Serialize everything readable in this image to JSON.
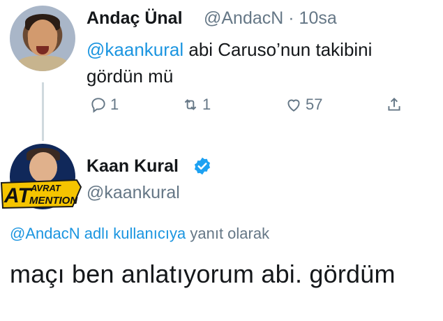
{
  "tweet1": {
    "display_name": "Andaç Ünal",
    "handle_time": "@AndacN · 10sa",
    "mention": "@kaankural",
    "text_after_mention": " abi Caruso’nun takibini",
    "text_line2": "gördün mü",
    "actions": {
      "reply_count": "1",
      "retweet_count": "1",
      "like_count": "57"
    }
  },
  "tweet2": {
    "display_name": "Kaan Kural",
    "handle": "@kaankural",
    "reply_mention": "@AndacN adlı kullanıcıya",
    "reply_suffix": " yanıt olarak",
    "text": "maçı ben anlatıyorum abi. gördüm"
  },
  "logo": {
    "line1": "AVRAT",
    "line2": "MENTION",
    "prefix": "AT"
  },
  "colors": {
    "link": "#1b95e0",
    "muted": "#657786",
    "text": "#14171a",
    "verified": "#1da1f2"
  },
  "icons": [
    "reply-icon",
    "retweet-icon",
    "like-icon",
    "share-icon",
    "verified-icon"
  ]
}
